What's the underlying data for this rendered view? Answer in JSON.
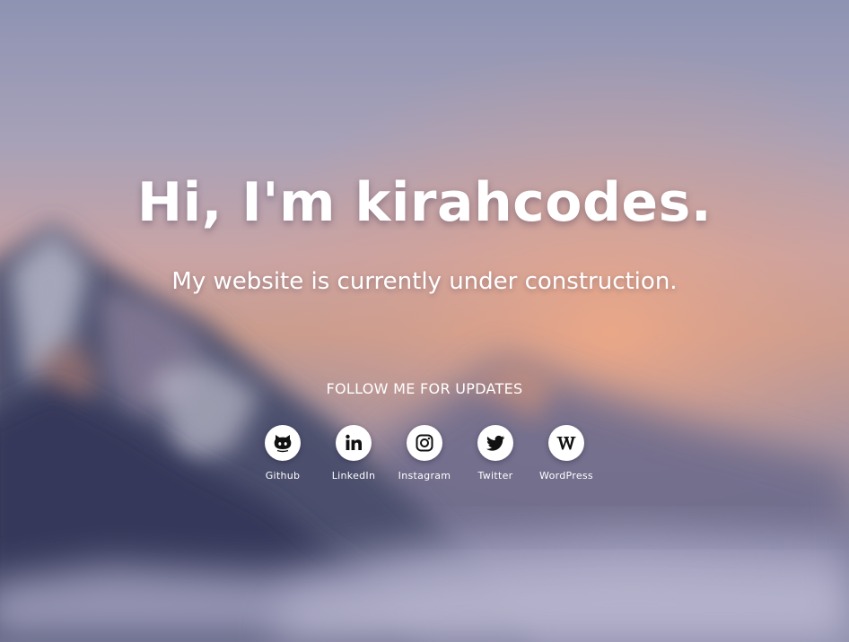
{
  "hero": {
    "title": "Hi, I'm kirahcodes.",
    "subtitle": "My website is currently under construction."
  },
  "follow": {
    "heading": "FOLLOW ME FOR UPDATES"
  },
  "socials": [
    {
      "label": "Github",
      "icon": "github-icon"
    },
    {
      "label": "LinkedIn",
      "icon": "linkedin-icon"
    },
    {
      "label": "Instagram",
      "icon": "instagram-icon"
    },
    {
      "label": "Twitter",
      "icon": "twitter-icon"
    },
    {
      "label": "WordPress",
      "icon": "wordpress-icon"
    }
  ],
  "colors": {
    "text": "#ffffff",
    "icon_bg": "#ffffff",
    "icon_fg": "#111111"
  }
}
